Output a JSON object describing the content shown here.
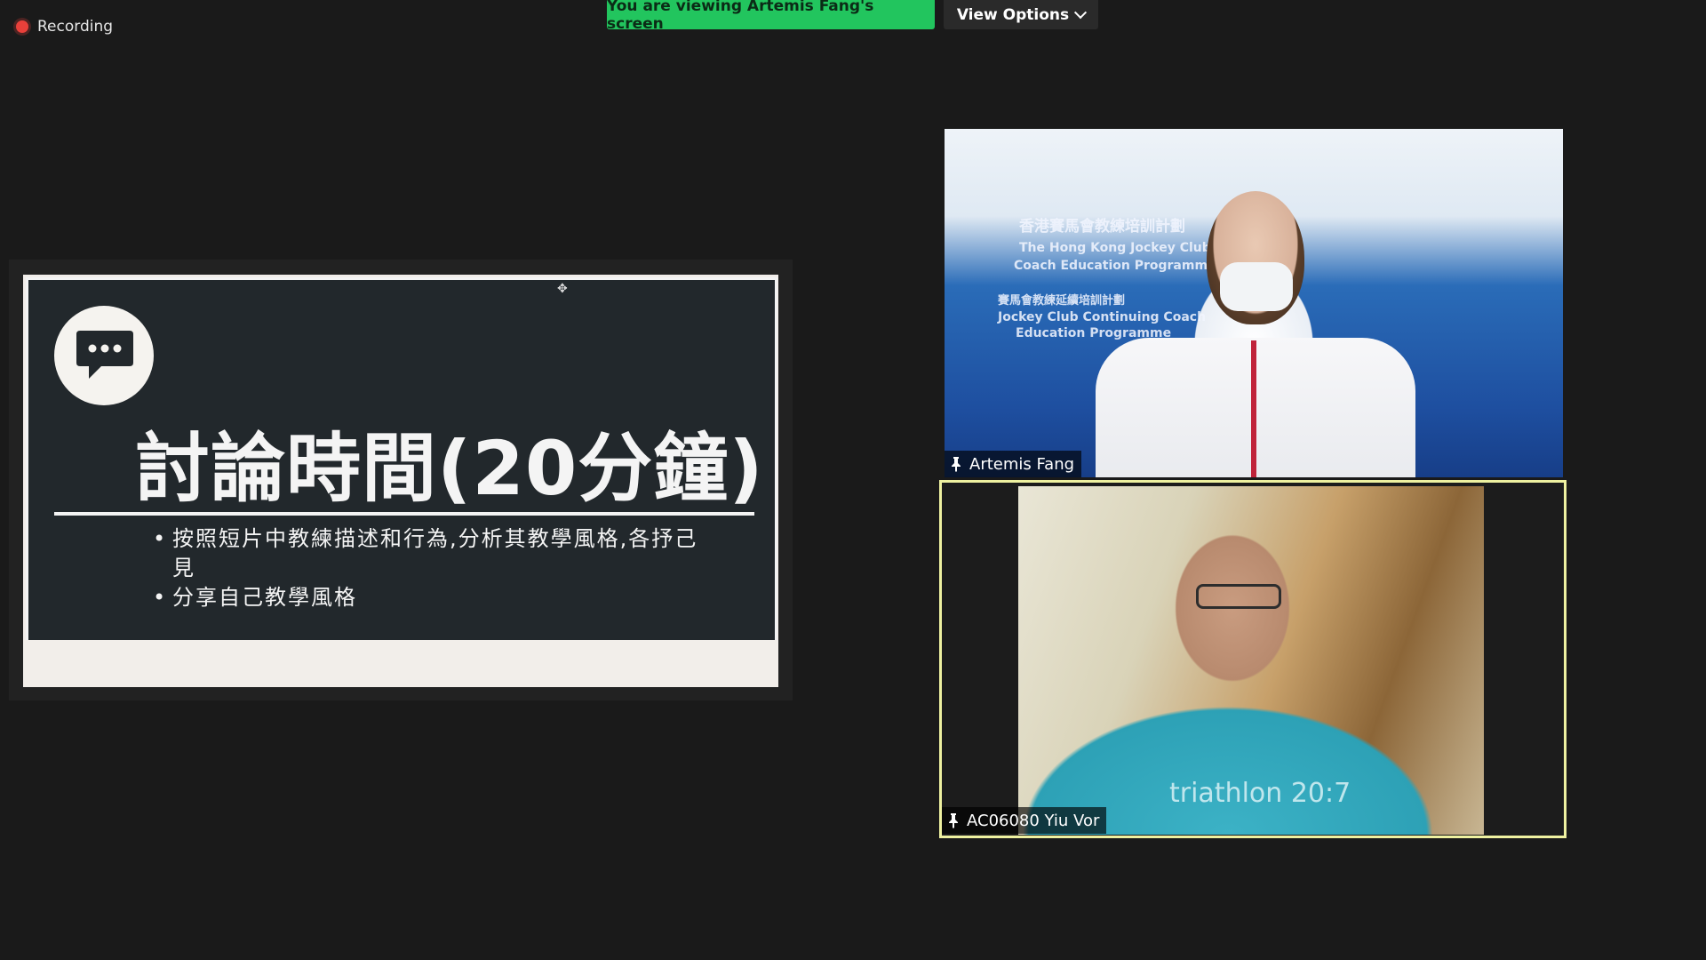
{
  "recording": {
    "label": "Recording"
  },
  "share": {
    "banner": "You are viewing Artemis Fang's screen",
    "view_options": "View Options"
  },
  "slide": {
    "title": "討論時間(20分鐘)",
    "bullets": [
      "按照短片中教練描述和行為,分析其教學風格,各抒己見",
      "分享自己教學風格"
    ]
  },
  "participants": [
    {
      "name": "Artemis Fang",
      "backdrop": [
        "香港賽馬會教練培訓計劃",
        "The Hong Kong Jockey Club",
        "Coach Education Programme",
        "賽馬會教練延續培訓計劃",
        "Jockey Club Continuing Coach",
        "Education Programme"
      ]
    },
    {
      "name": "AC06080 Yiu Vor",
      "shirt_text": "triathlon 20:7"
    }
  ],
  "colors": {
    "share_green": "#22c55e",
    "active_speaker": "#eef1a0",
    "record_red": "#e8403a"
  }
}
